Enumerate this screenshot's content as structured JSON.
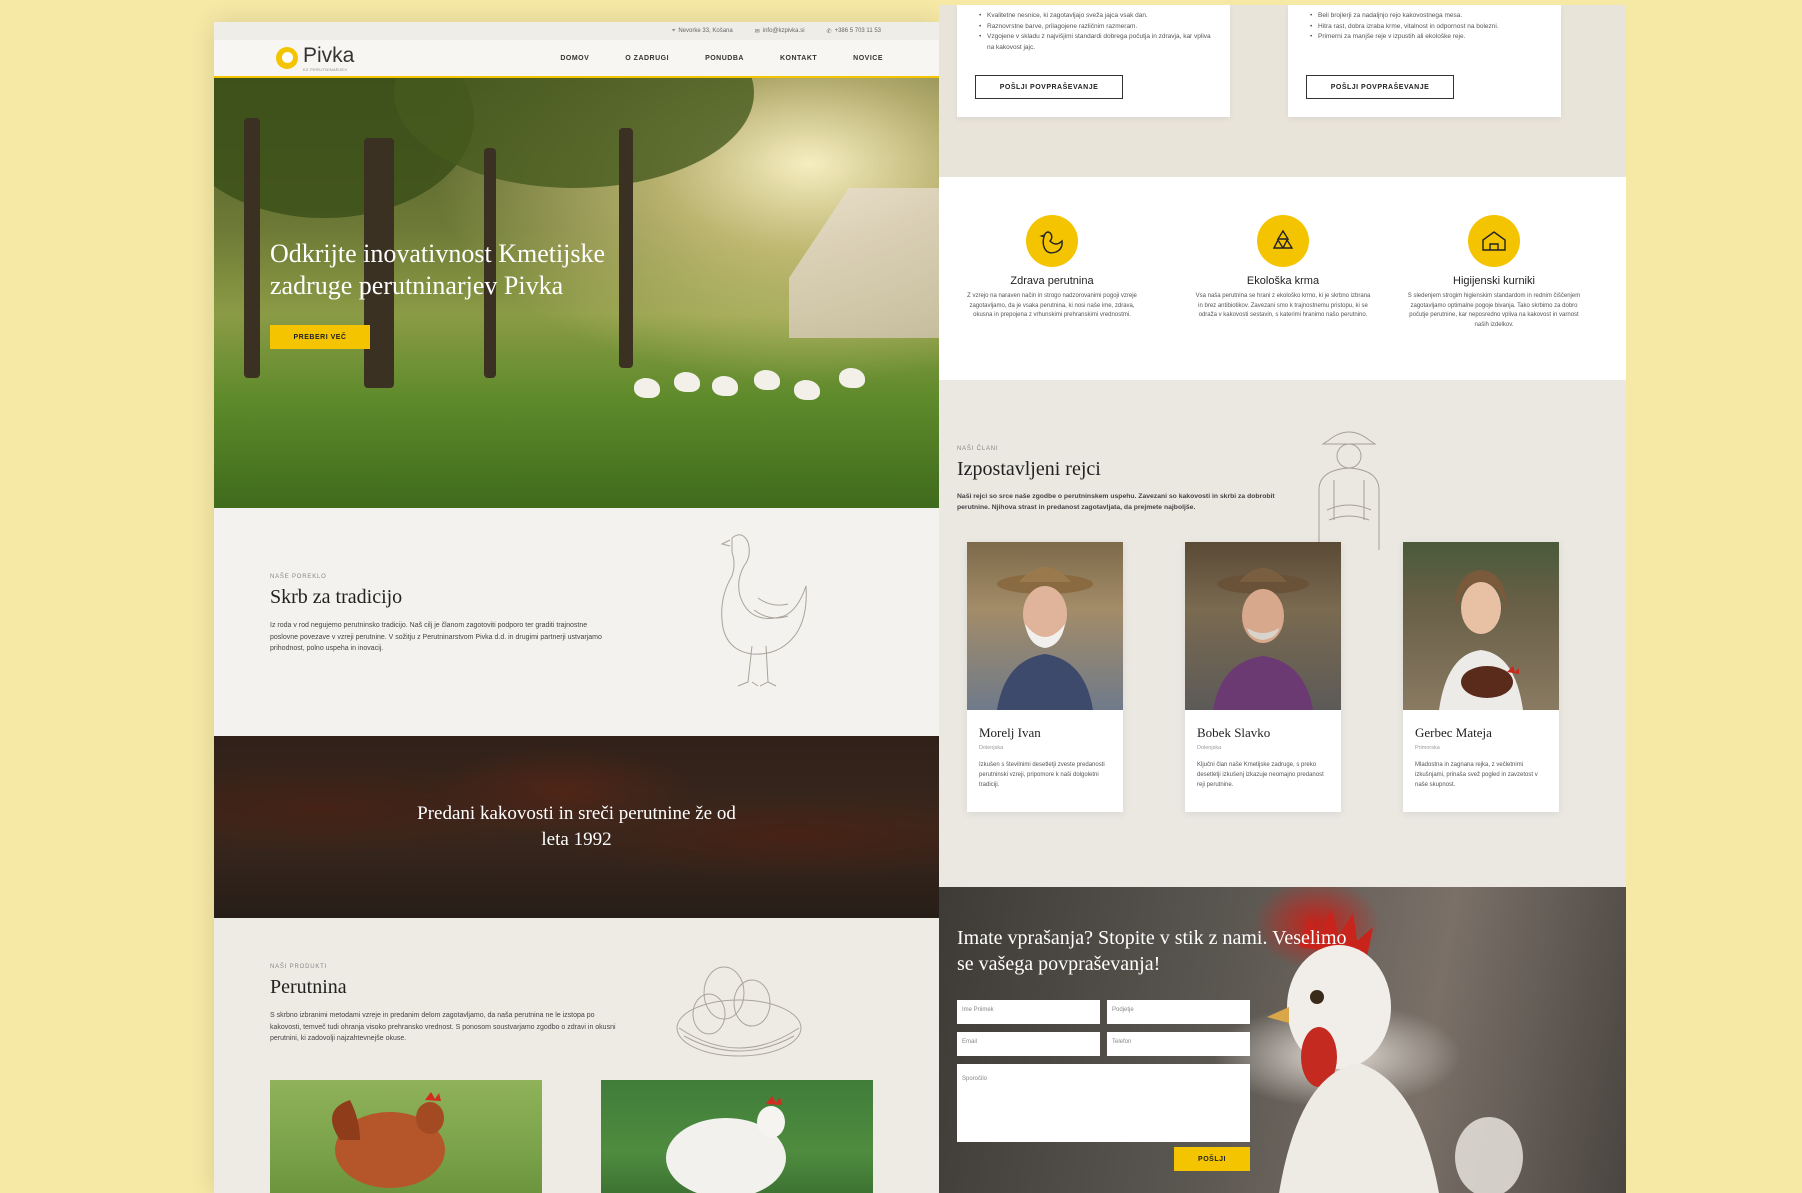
{
  "left": {
    "topbar": {
      "address": "Nevorke 33, Košana",
      "email": "info@kzpivka.si",
      "phone": "+386 5 703 11 53"
    },
    "logo": {
      "text": "Pivka",
      "sub": "KZ PERUTNINARJEV"
    },
    "menu": [
      "DOMOV",
      "O ZADRUGI",
      "PONUDBA",
      "KONTAKT",
      "NOVICE"
    ],
    "hero": {
      "title": "Odkrijte inovativnost Kmetijske zadruge perutninarjev Pivka",
      "button": "PREBERI VEČ"
    },
    "origin": {
      "eyebrow": "NAŠE POREKLO",
      "title": "Skrb za tradicijo",
      "text": "Iz roda v rod negujemo perutninsko tradicijo. Naš cilj je članom zagotoviti podporo ter graditi trajnostne poslovne povezave v vzreji perutnine. V sožitju z Perutninarstvom Pivka d.d. in drugimi partnerji ustvarjamo prihodnost, polno uspeha in inovacij."
    },
    "banner": {
      "text": "Predani kakovosti in sreči perutnine že od leta 1992"
    },
    "products": {
      "eyebrow": "NAŠI PRODUKTI",
      "title": "Perutnina",
      "text": "S skrbno izbranimi metodami vzreje in predanim delom zagotavljamo, da naša perutnina ne le izstopa po kakovosti, temveč tudi ohranja visoko prehransko vrednost. S ponosom soustvarjamo zgodbo o zdravi in okusni perutnini, ki zadovolji najzahtevnejše okuse."
    }
  },
  "right": {
    "offers": [
      {
        "bullets": [
          "Kvalitetne nesnice, ki zagotavljajo sveža jajca vsak dan.",
          "Raznovrstne barve, prilagojene različnim razmeram.",
          "Vzgojene v skladu z najvišjimi standardi dobrega počutja in zdravja, kar vpliva na kakovost jajc."
        ],
        "button": "POŠLJI POVPRAŠEVANJE"
      },
      {
        "bullets": [
          "Beli brojlerji za nadaljnjo rejo kakovostnega mesa.",
          "Hitra rast, dobra izraba krme, vitalnost in odpornost na bolezni.",
          "Primerni za manjše reje v izpustih ali ekološke reje."
        ],
        "button": "POŠLJI POVPRAŠEVANJE"
      }
    ],
    "features": [
      {
        "icon": "chicken-icon",
        "title": "Zdrava perutnina",
        "text": "Z vzrejo na naraven način in strogo nadzorovanimi pogoji vzreje zagotavljamo, da je vsaka perutnina, ki nosi naše ime, zdrava, okusna in prepojena z vrhunskimi prehranskimi vrednostmi."
      },
      {
        "icon": "recycle-icon",
        "title": "Ekološka krma",
        "text": "Vsa naša perutnina se hrani z ekološko krmo, ki je skrbno izbrana in brez antibiotikov. Zavezani smo k trajnostnemu pristopu, ki se odraža v kakovosti sestavin, s katerimi hranimo našo perutnino."
      },
      {
        "icon": "coop-icon",
        "title": "Higijenski kurniki",
        "text": "S sledenjem strogim higienskim standardom in rednim čiščenjem zagotavljamo optimalne pogoje bivanja. Tako skrbimo za dobro počutje perutnine, kar neposredno vpliva na kakovost in varnost naših izdelkov."
      }
    ],
    "breeders_section": {
      "eyebrow": "NAŠI ČLANI",
      "title": "Izpostavljeni rejci",
      "text": "Naši rejci so srce naše zgodbe o perutninskem uspehu. Zavezani so kakovosti in skrbi za dobrobit perutnine. Njihova strast in predanost zagotavljata, da prejmete najboljše."
    },
    "breeders": [
      {
        "name": "Morelj Ivan",
        "region": "Dolenjska",
        "text": "Izkušen s številnimi desetletji zveste predanosti perutninski vzreji, pripomore k naši dolgoletni tradiciji."
      },
      {
        "name": "Bobek Slavko",
        "region": "Dolenjska",
        "text": "Ključni član naše Kmetijske zadruge, s preko desetletji izkušenj izkazuje neomajno predanost reji perutnine."
      },
      {
        "name": "Gerbec Mateja",
        "region": "Primorska",
        "text": "Mladostna in zagnana rejka, z večletnimi izkušnjami, prinaša svež pogled in zavzetost v naše skupnost."
      }
    ],
    "contact": {
      "title": "Imate vprašanja? Stopite v stik z nami. Veselimo se vašega povpraševanja!",
      "fields": {
        "name": "Ime Priimek",
        "company": "Podjetje",
        "email": "Email",
        "phone": "Telefon",
        "message": "Sporočilo"
      },
      "button": "POŠLJI"
    }
  },
  "colors": {
    "background": "#f6e8a5",
    "accent": "#f4c400"
  }
}
